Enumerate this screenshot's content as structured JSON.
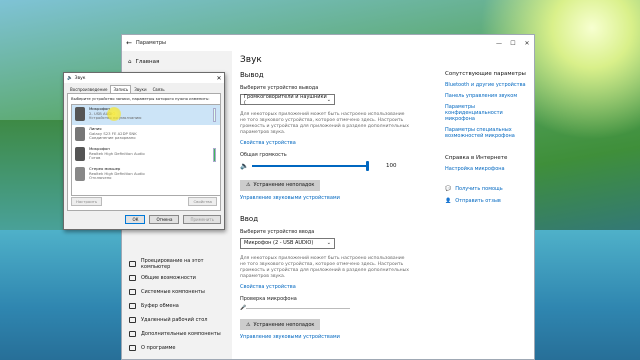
{
  "settings": {
    "title": "Параметры",
    "home": "Главная",
    "left_items": [
      "Проецирование на этот компьютер",
      "Общие возможности",
      "Системные компоненты",
      "Буфер обмена",
      "Удаленный рабочий стол",
      "Дополнительные компоненты",
      "О программе"
    ],
    "page_title": "Звук",
    "output": {
      "heading": "Вывод",
      "select_label": "Выберите устройство вывода",
      "device": "Громкоговорители и наушники (",
      "para": "Для некоторых приложений может быть настроено использование не того звукового устройства, которое отмечено здесь. Настроить громкость и устройства для приложений в разделе дополнительных параметров звука.",
      "props_link": "Свойства устройства",
      "volume_label": "Общая громкость",
      "volume": 100,
      "troubleshoot": "Устранение неполадок",
      "manage_link": "Управление звуковыми устройствами"
    },
    "input": {
      "heading": "Ввод",
      "select_label": "Выберите устройство ввода",
      "device": "Микрофон (2 - USB AUDIO)",
      "para": "Для некоторых приложений может быть настроено использование не того звукового устройства, которое отмечено здесь. Настроить громкость и устройства для приложений в разделе дополнительных параметров звука.",
      "props_link": "Свойства устройства",
      "test_label": "Проверка микрофона",
      "troubleshoot": "Устранение неполадок",
      "manage_link": "Управление звуковыми устройствами"
    },
    "related": {
      "heading": "Сопутствующие параметры",
      "links": [
        "Bluetooth и другие устройства",
        "Панель управления звуком",
        "Параметры конфиденциальности микрофона",
        "Параметры специальных возможностей микрофона"
      ]
    },
    "help": {
      "heading": "Справка в Интернете",
      "link": "Настройка микрофона",
      "get_help": "Получить помощь",
      "feedback": "Отправить отзыв"
    }
  },
  "sound_dialog": {
    "title": "Звук",
    "tabs": [
      "Воспроизведение",
      "Запись",
      "Звуки",
      "Связь"
    ],
    "active_tab": 1,
    "hint": "Выберите устройство записи, параметры которого нужно изменить:",
    "devices": [
      {
        "name": "Микрофон",
        "sub1": "2- USB AUDIO",
        "sub2": "Устройство по умолчанию"
      },
      {
        "name": "Линия",
        "sub1": "Galaxy S23 FE A2DP SNK",
        "sub2": "Соединение разорвано"
      },
      {
        "name": "Микрофон",
        "sub1": "Realtek High Definition Audio",
        "sub2": "Готов"
      },
      {
        "name": "Стерео микшер",
        "sub1": "Realtek High Definition Audio",
        "sub2": "Отключено"
      }
    ],
    "configure": "Настроить",
    "properties_small": "Свойства",
    "ok": "ОК",
    "cancel": "Отмена",
    "apply": "Применить"
  }
}
